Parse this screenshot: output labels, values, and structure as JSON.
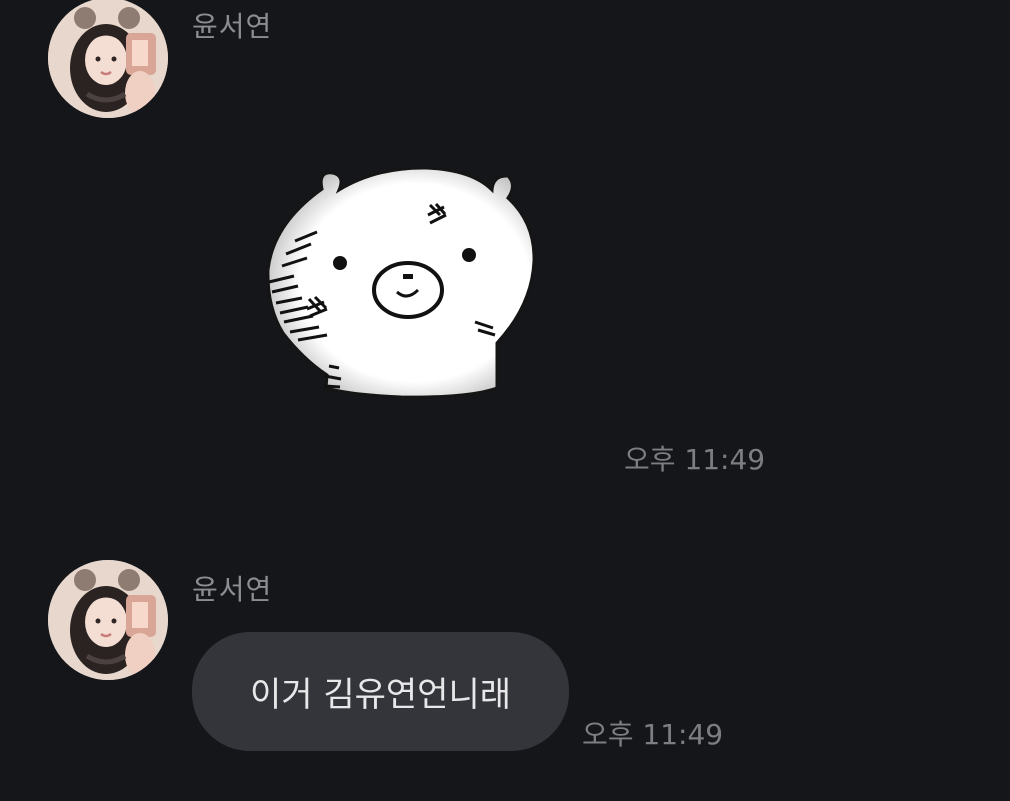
{
  "messages": [
    {
      "sender": "윤서연",
      "type": "sticker",
      "sticker": "white-bear-sticker",
      "time": "오후 11:49"
    },
    {
      "sender": "윤서연",
      "type": "text",
      "text": "이거 김유연언니래",
      "time": "오후 11:49"
    }
  ],
  "colors": {
    "background": "#15161a",
    "bubble": "#34353b",
    "sender_text": "#8c8d92",
    "time_text": "#7d7e83",
    "message_text": "#e8e8ea"
  }
}
